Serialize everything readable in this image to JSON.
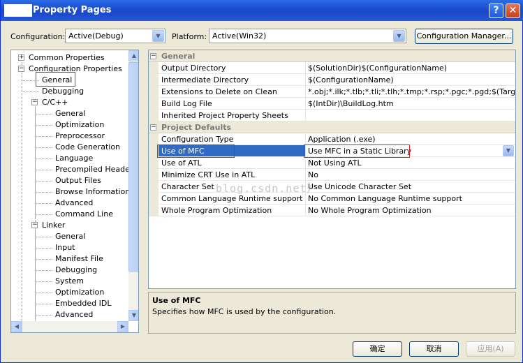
{
  "title": {
    "text": "Property Pages",
    "help_label": "?",
    "close_label": "✕"
  },
  "toolbar": {
    "configuration_label": "Configuration:",
    "configuration_value": "Active(Debug)",
    "platform_label": "Platform:",
    "platform_value": "Active(Win32)",
    "config_manager_label": "Configuration Manager..."
  },
  "tree": {
    "items": [
      {
        "label": "Common Properties"
      },
      {
        "label": "Configuration Properties"
      },
      {
        "label": "General"
      },
      {
        "label": "Debugging"
      },
      {
        "label": "C/C++"
      },
      {
        "label": "General"
      },
      {
        "label": "Optimization"
      },
      {
        "label": "Preprocessor"
      },
      {
        "label": "Code Generation"
      },
      {
        "label": "Language"
      },
      {
        "label": "Precompiled Headers"
      },
      {
        "label": "Output Files"
      },
      {
        "label": "Browse Information"
      },
      {
        "label": "Advanced"
      },
      {
        "label": "Command Line"
      },
      {
        "label": "Linker"
      },
      {
        "label": "General"
      },
      {
        "label": "Input"
      },
      {
        "label": "Manifest File"
      },
      {
        "label": "Debugging"
      },
      {
        "label": "System"
      },
      {
        "label": "Optimization"
      },
      {
        "label": "Embedded IDL"
      },
      {
        "label": "Advanced"
      }
    ]
  },
  "grid": {
    "sections": [
      {
        "name": "General",
        "rows": [
          {
            "name": "Output Directory",
            "value": "$(SolutionDir)$(ConfigurationName)"
          },
          {
            "name": "Intermediate Directory",
            "value": "$(ConfigurationName)"
          },
          {
            "name": "Extensions to Delete on Clean",
            "value": "*.obj;*.ilk;*.tlb;*.tli;*.tlh;*.tmp;*.rsp;*.pgc;*.pgd;$(TargetF"
          },
          {
            "name": "Build Log File",
            "value": "$(IntDir)\\BuildLog.htm"
          },
          {
            "name": "Inherited Project Property Sheets",
            "value": ""
          }
        ]
      },
      {
        "name": "Project Defaults",
        "rows": [
          {
            "name": "Configuration Type",
            "value": "Application (.exe)"
          },
          {
            "name": "Use of MFC",
            "value": "Use MFC in a Static Library"
          },
          {
            "name": "Use of ATL",
            "value": "Not Using ATL"
          },
          {
            "name": "Minimize CRT Use in ATL",
            "value": "No"
          },
          {
            "name": "Character Set",
            "value": "Use Unicode Character Set"
          },
          {
            "name": "Common Language Runtime support",
            "value": "No Common Language Runtime support"
          },
          {
            "name": "Whole Program Optimization",
            "value": "No Whole Program Optimization"
          }
        ]
      }
    ]
  },
  "description": {
    "title": "Use of MFC",
    "text": "Specifies how MFC is used by the configuration."
  },
  "watermark": "blog.csdn.net/",
  "buttons": {
    "ok": "确定",
    "cancel": "取消",
    "apply": "应用(A)"
  },
  "colors": {
    "selection": "#316ac5",
    "highlight_box": "#e8181c",
    "titlebar": "#1b4fd0"
  }
}
